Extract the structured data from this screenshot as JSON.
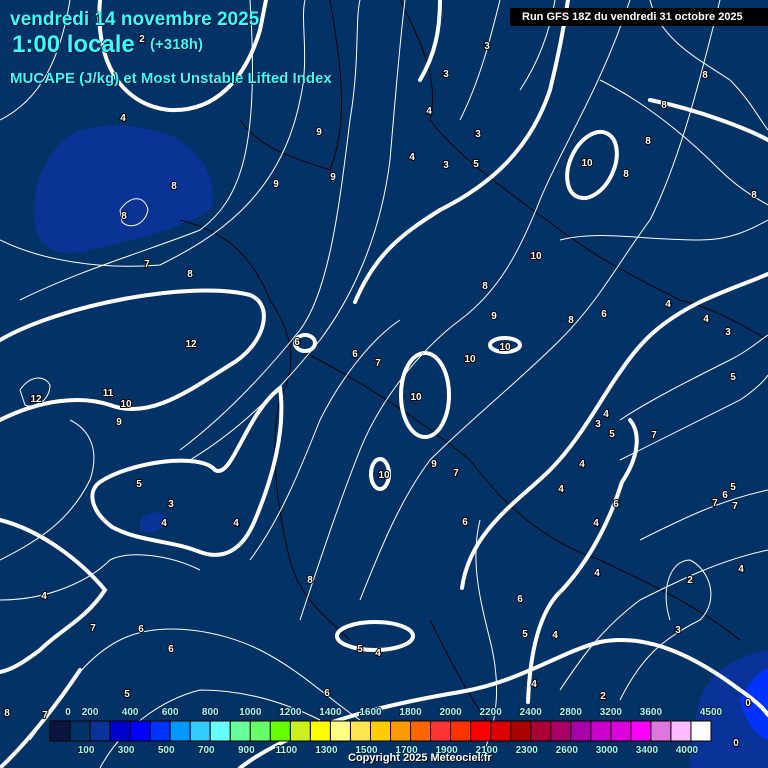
{
  "header": {
    "date": "vendredi 14 novembre 2025",
    "time": "1:00 locale",
    "offset": "(+318h)",
    "parameter": "MUCAPE (J/kg) et Most Unstable Lifted Index",
    "run": "Run GFS 18Z du vendredi 31 octobre 2025"
  },
  "legend": {
    "top_labels": [
      "0",
      "200",
      "400",
      "600",
      "800",
      "1000",
      "1200",
      "1400",
      "1600",
      "1800",
      "2000",
      "2200",
      "2400",
      "2800",
      "3200",
      "3600",
      "4500"
    ],
    "bottom_labels": [
      "100",
      "300",
      "500",
      "700",
      "900",
      "1100",
      "1300",
      "1500",
      "1700",
      "1900",
      "2100",
      "2300",
      "2600",
      "3000",
      "3400",
      "4000"
    ],
    "colors": [
      "#0a1640",
      "#033366",
      "#0a3399",
      "#0000cc",
      "#0000ff",
      "#0033ff",
      "#0099ff",
      "#33ccff",
      "#66ffff",
      "#66ff99",
      "#66ff66",
      "#66ff00",
      "#ccf01c",
      "#ffff00",
      "#ffff88",
      "#ffe650",
      "#ffcc00",
      "#ff9900",
      "#ff6600",
      "#ff3333",
      "#ff3300",
      "#ff0000",
      "#dd0000",
      "#aa0000",
      "#aa0033",
      "#aa0066",
      "#aa00aa",
      "#cc00cc",
      "#dd00dd",
      "#ff00ff",
      "#dd77dd",
      "#ffbbff",
      "#ffffff"
    ]
  },
  "contour_labels": [
    "4",
    "2",
    "8",
    "8",
    "7",
    "8",
    "9",
    "9",
    "9",
    "3",
    "3",
    "4",
    "4",
    "3",
    "3",
    "5",
    "8",
    "8",
    "8",
    "10",
    "8",
    "8",
    "10",
    "8",
    "9",
    "8",
    "6",
    "4",
    "4",
    "3",
    "5",
    "6",
    "6",
    "7",
    "10",
    "10",
    "12",
    "12",
    "11",
    "10",
    "9",
    "10",
    "4",
    "3",
    "5",
    "7",
    "4",
    "10",
    "9",
    "7",
    "5",
    "3",
    "4",
    "4",
    "6",
    "4",
    "6",
    "4",
    "7",
    "6",
    "7",
    "5",
    "8",
    "4",
    "2",
    "4",
    "4",
    "7",
    "6",
    "6",
    "5",
    "4",
    "3",
    "5",
    "4",
    "6",
    "5",
    "6",
    "4",
    "2",
    "0",
    "0",
    "8",
    "7"
  ],
  "copyright": "Copyright 2025 Meteociel.fr",
  "colors": {
    "background": "#033366",
    "title": "#33ffff",
    "unstable_area": "#0a3399"
  }
}
